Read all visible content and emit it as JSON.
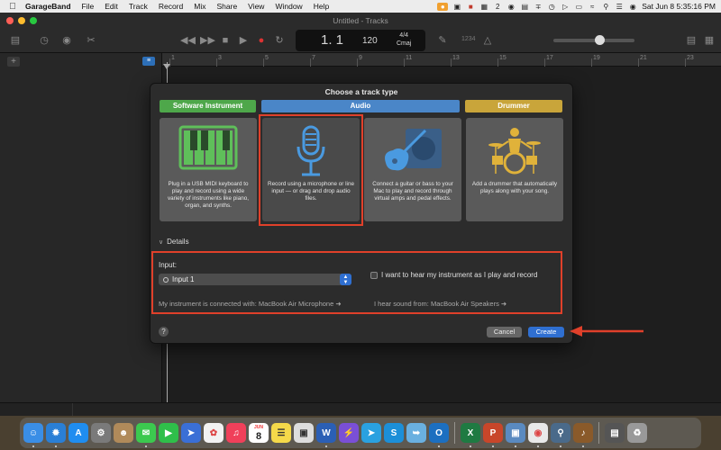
{
  "menubar": {
    "app_name": "GarageBand",
    "items": [
      "File",
      "Edit",
      "Track",
      "Record",
      "Mix",
      "Share",
      "View",
      "Window",
      "Help"
    ],
    "status_badge_count": "2",
    "clock": "Sat Jun 8  5:35:16 PM"
  },
  "window": {
    "title": "Untitled - Tracks"
  },
  "lcd": {
    "bar_beat": "1. 1",
    "tempo": "120",
    "time_signature": "4/4",
    "key": "Cmaj"
  },
  "toolbar": {
    "cpu_label": "1234"
  },
  "ruler": {
    "ticks": [
      "1",
      "3",
      "5",
      "7",
      "9",
      "11",
      "13",
      "15",
      "17",
      "19",
      "21",
      "23"
    ]
  },
  "modal": {
    "title": "Choose a track type",
    "categories": [
      {
        "label": "Software Instrument",
        "color": "#4ea74a"
      },
      {
        "label": "Audio",
        "color": "#4a86c8"
      },
      {
        "label": "Drummer",
        "color": "#c9a53a"
      }
    ],
    "cards": [
      {
        "name": "software-instrument",
        "desc": "Plug in a USB MIDI keyboard to play and record using a wide variety of instruments like piano, organ, and synths."
      },
      {
        "name": "audio-microphone",
        "desc": "Record using a microphone or line input — or drag and drop audio files."
      },
      {
        "name": "audio-guitar",
        "desc": "Connect a guitar or bass to your Mac to play and record through virtual amps and pedal effects."
      },
      {
        "name": "drummer",
        "desc": "Add a drummer that automatically plays along with your song."
      }
    ],
    "details_label": "Details",
    "input_label": "Input:",
    "input_value": "Input 1",
    "monitor_label": "I want to hear my instrument as I play and record",
    "instrument_connected": "My instrument is connected with: MacBook Air Microphone",
    "sound_from": "I hear sound from: MacBook Air Speakers",
    "help_label": "?",
    "cancel_label": "Cancel",
    "create_label": "Create"
  },
  "dock": {
    "calendar_month": "JUN",
    "calendar_day": "8"
  },
  "colors": {
    "highlight": "#e0402a",
    "accent_blue": "#2f6fd1"
  }
}
